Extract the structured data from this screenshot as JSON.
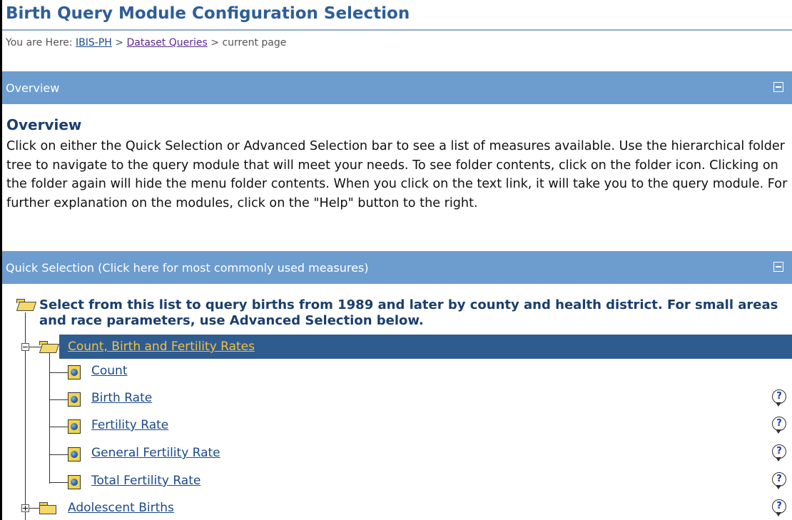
{
  "page": {
    "title": "Birth Query Module Configuration Selection"
  },
  "breadcrumb": {
    "prefix": "You are Here:",
    "sep1": ">",
    "link1": "IBIS-PH",
    "sep2": ">",
    "link2": "Dataset Queries",
    "current": "> current page"
  },
  "overview_bar": {
    "label": "Overview",
    "toggle_icon": "collapse-icon"
  },
  "overview": {
    "heading": "Overview",
    "text": "Click on either the Quick Selection or Advanced Selection bar to see a list of measures available. Use the hierarchical folder tree to navigate to the query module that will meet your needs. To see folder contents, click on the folder icon. Clicking on the folder again will hide the menu folder contents. When you click on the text link, it will take you to the query module. For further explanation on the modules, click on the \"Help\" button to the right."
  },
  "quick_bar": {
    "label": "Quick Selection (Click here for most commonly used measures)",
    "toggle_icon": "collapse-icon"
  },
  "tree": {
    "heading": "Select from this list to query births from 1989 and later by county and health district. For small areas and race parameters, use Advanced Selection below.",
    "folder_open": {
      "label": "Count, Birth and Fertility Rates"
    },
    "items": [
      {
        "label": "Count"
      },
      {
        "label": "Birth Rate"
      },
      {
        "label": "Fertility Rate"
      },
      {
        "label": "General Fertility Rate"
      },
      {
        "label": "Total Fertility Rate"
      }
    ],
    "folder_closed": {
      "label": "Adolescent Births"
    },
    "help_glyph": "?"
  },
  "colors": {
    "bar": "#6d9dcf",
    "selected_row": "#2f5c8f",
    "title": "#2e5e97",
    "link": "#1a4a8a",
    "selected_link": "#f2c045"
  }
}
